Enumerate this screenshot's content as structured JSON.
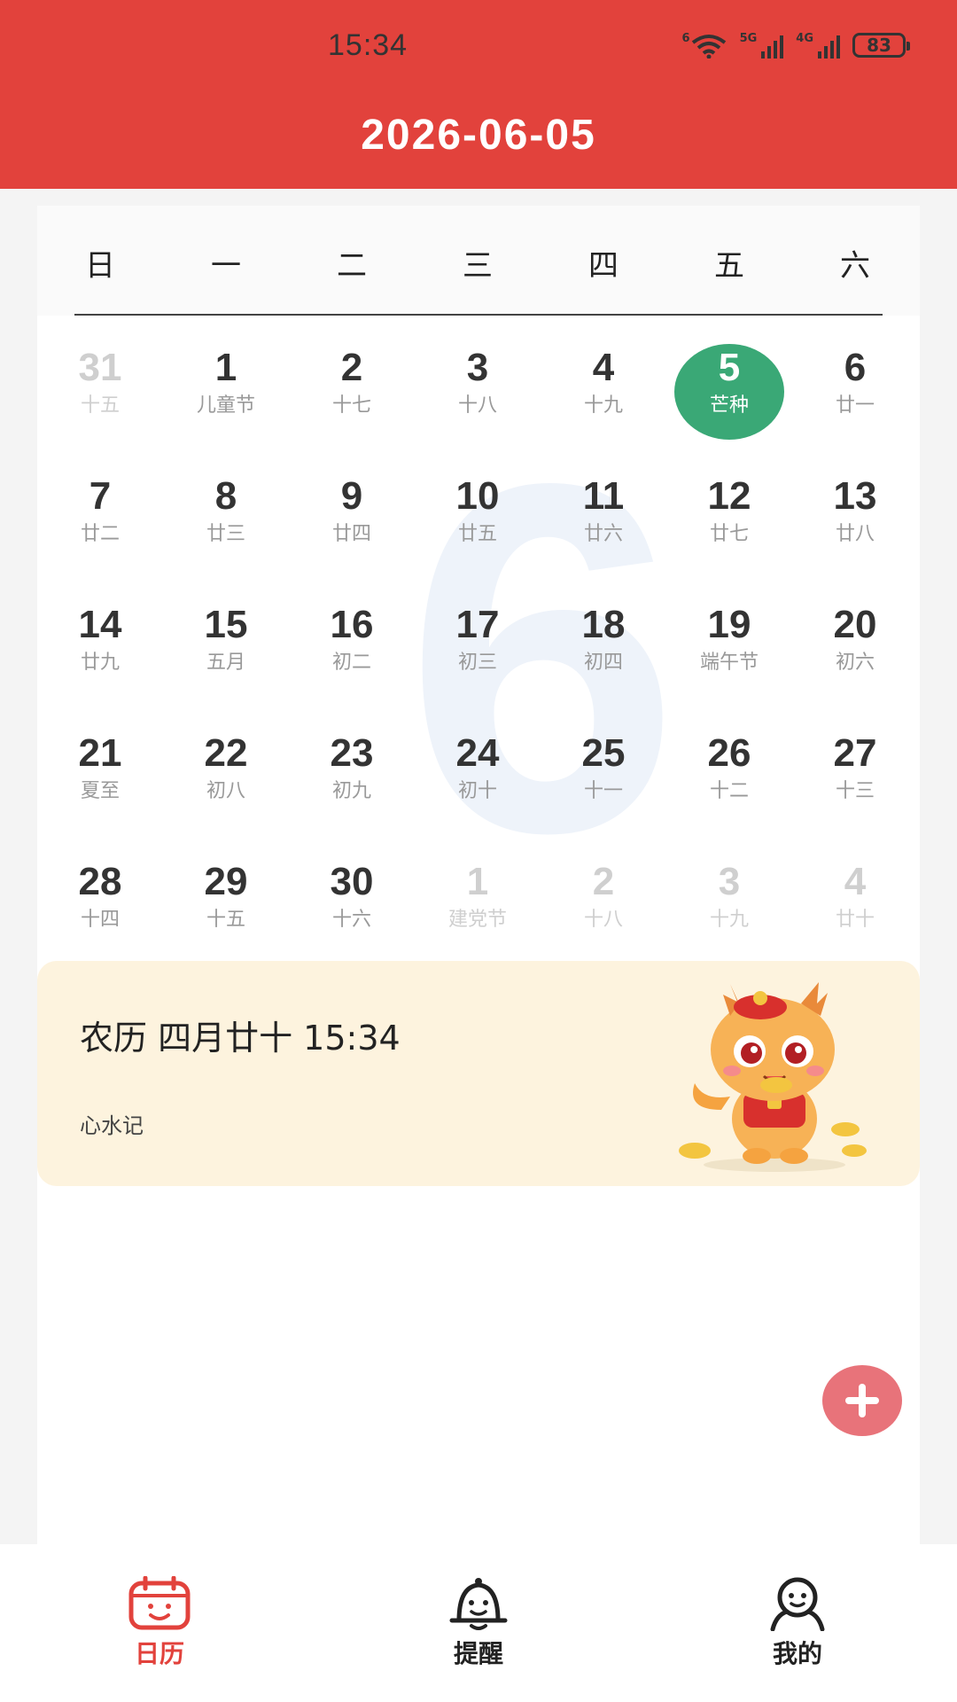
{
  "status_bar": {
    "time": "15:34",
    "wifi_badge": "6",
    "signal1": "5G",
    "signal2": "4G",
    "battery": "83"
  },
  "header": {
    "date": "2026-06-05"
  },
  "weekdays": [
    "日",
    "一",
    "二",
    "三",
    "四",
    "五",
    "六"
  ],
  "watermark_month": "6",
  "days": [
    {
      "num": "31",
      "sub": "十五",
      "dim": true
    },
    {
      "num": "1",
      "sub": "儿童节"
    },
    {
      "num": "2",
      "sub": "十七"
    },
    {
      "num": "3",
      "sub": "十八"
    },
    {
      "num": "4",
      "sub": "十九"
    },
    {
      "num": "5",
      "sub": "芒种",
      "selected": true
    },
    {
      "num": "6",
      "sub": "廿一"
    },
    {
      "num": "7",
      "sub": "廿二"
    },
    {
      "num": "8",
      "sub": "廿三"
    },
    {
      "num": "9",
      "sub": "廿四"
    },
    {
      "num": "10",
      "sub": "廿五"
    },
    {
      "num": "11",
      "sub": "廿六"
    },
    {
      "num": "12",
      "sub": "廿七"
    },
    {
      "num": "13",
      "sub": "廿八"
    },
    {
      "num": "14",
      "sub": "廿九"
    },
    {
      "num": "15",
      "sub": "五月"
    },
    {
      "num": "16",
      "sub": "初二"
    },
    {
      "num": "17",
      "sub": "初三"
    },
    {
      "num": "18",
      "sub": "初四"
    },
    {
      "num": "19",
      "sub": "端午节"
    },
    {
      "num": "20",
      "sub": "初六"
    },
    {
      "num": "21",
      "sub": "夏至"
    },
    {
      "num": "22",
      "sub": "初八"
    },
    {
      "num": "23",
      "sub": "初九"
    },
    {
      "num": "24",
      "sub": "初十"
    },
    {
      "num": "25",
      "sub": "十一"
    },
    {
      "num": "26",
      "sub": "十二"
    },
    {
      "num": "27",
      "sub": "十三"
    },
    {
      "num": "28",
      "sub": "十四"
    },
    {
      "num": "29",
      "sub": "十五"
    },
    {
      "num": "30",
      "sub": "十六"
    },
    {
      "num": "1",
      "sub": "建党节",
      "dim": true
    },
    {
      "num": "2",
      "sub": "十八",
      "dim": true
    },
    {
      "num": "3",
      "sub": "十九",
      "dim": true
    },
    {
      "num": "4",
      "sub": "廿十",
      "dim": true
    }
  ],
  "info": {
    "title": "农历 四月廿十 15:34",
    "subtitle": "心水记",
    "image_icon": "dragon-mascot-icon"
  },
  "fab": {
    "icon": "plus-icon"
  },
  "nav": [
    {
      "label": "日历",
      "icon": "calendar-icon",
      "active": true
    },
    {
      "label": "提醒",
      "icon": "bell-icon",
      "active": false
    },
    {
      "label": "我的",
      "icon": "profile-icon",
      "active": false
    }
  ],
  "colors": {
    "header": "#e2423c",
    "selected_day": "#3aa876",
    "banner": "#fdf3de",
    "fab": "#e8737a"
  }
}
